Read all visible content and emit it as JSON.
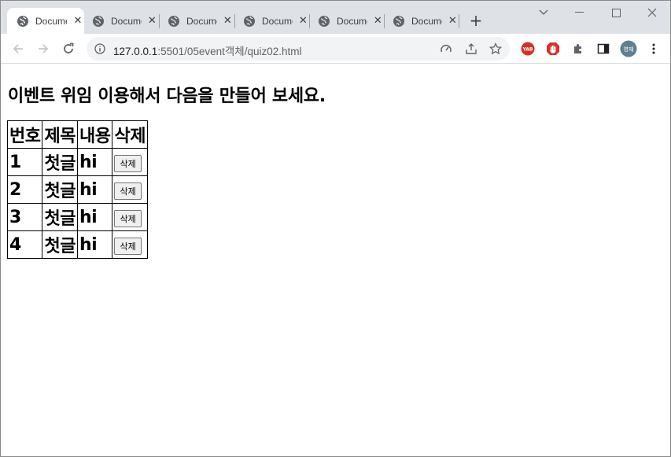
{
  "browser": {
    "tabs": [
      {
        "title": "Document",
        "active": true
      },
      {
        "title": "Document",
        "active": false
      },
      {
        "title": "Document",
        "active": false
      },
      {
        "title": "Document",
        "active": false
      },
      {
        "title": "Document",
        "active": false
      },
      {
        "title": "Document",
        "active": false
      }
    ],
    "url_host": "127.0.0.1",
    "url_path": ":5501/05event객체/quiz02.html",
    "profile_label": "영재",
    "ext_adblock_label": "YAB"
  },
  "page": {
    "heading": "이벤트 위임 이용해서 다음을 만들어 보세요.",
    "table": {
      "headers": [
        "번호",
        "제목",
        "내용",
        "삭제"
      ],
      "rows": [
        {
          "num": "1",
          "title": "첫글",
          "content": "hi",
          "delete_label": "삭제"
        },
        {
          "num": "2",
          "title": "첫글",
          "content": "hi",
          "delete_label": "삭제"
        },
        {
          "num": "3",
          "title": "첫글",
          "content": "hi",
          "delete_label": "삭제"
        },
        {
          "num": "4",
          "title": "첫글",
          "content": "hi",
          "delete_label": "삭제"
        }
      ]
    }
  },
  "colors": {
    "tabstrip_bg": "#dee1e6",
    "omnibox_bg": "#f1f3f4",
    "ext_red": "#d93025",
    "profile_bg": "#5f7f8f"
  }
}
